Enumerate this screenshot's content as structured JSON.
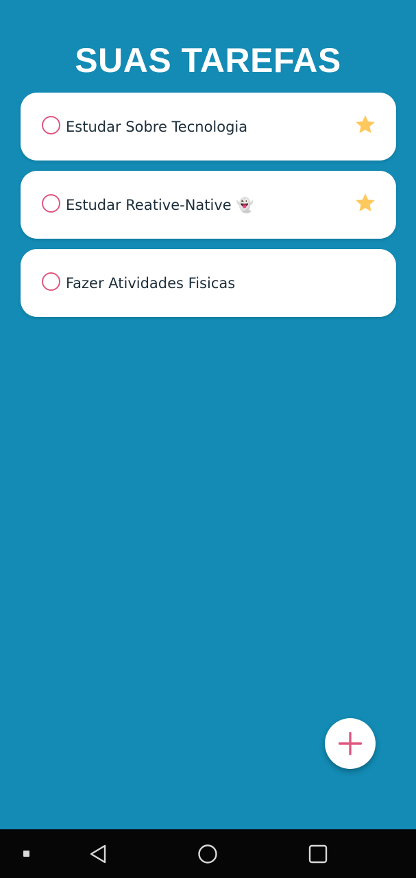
{
  "header": {
    "title": "SUAS TAREFAS"
  },
  "tasks": [
    {
      "label": "Estudar Sobre Tecnologia",
      "starred": true
    },
    {
      "label": "Estudar Reative-Native 👻",
      "starred": true
    },
    {
      "label": "Fazer Atividades Fisicas",
      "starred": false
    }
  ],
  "fab": {
    "icon": "plus-icon"
  },
  "navbar": {
    "items": [
      "recents-dot-icon",
      "back-icon",
      "home-icon",
      "overview-icon"
    ]
  },
  "colors": {
    "background": "#138bb4",
    "card": "#ffffff",
    "checkbox_border": "#e0577f",
    "star": "#ffc85c",
    "fab_plus": "#e0577f",
    "text": "#1d2e3a",
    "navbar": "#060606"
  }
}
